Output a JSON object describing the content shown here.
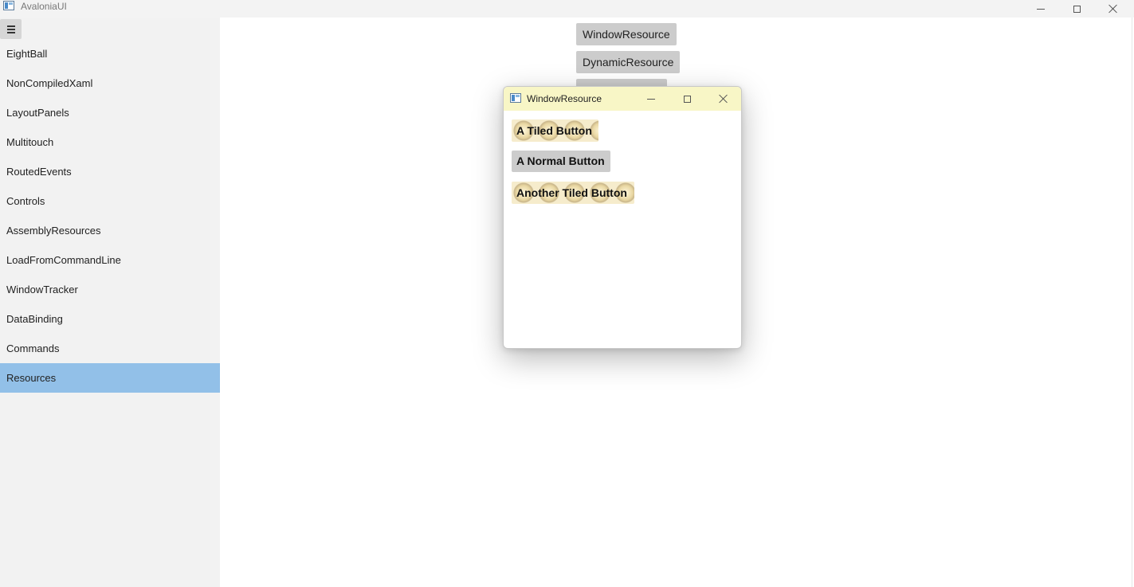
{
  "window": {
    "title": "AvaloniaUI"
  },
  "sidebar": {
    "items": [
      {
        "label": "EightBall"
      },
      {
        "label": "NonCompiledXaml"
      },
      {
        "label": "LayoutPanels"
      },
      {
        "label": "Multitouch"
      },
      {
        "label": "RoutedEvents"
      },
      {
        "label": "Controls"
      },
      {
        "label": "AssemblyResources"
      },
      {
        "label": "LoadFromCommandLine"
      },
      {
        "label": "WindowTracker"
      },
      {
        "label": "DataBinding"
      },
      {
        "label": "Commands"
      },
      {
        "label": "Resources"
      }
    ],
    "selected": "Resources"
  },
  "main": {
    "window_resource_label": "WindowResource",
    "dynamic_resource_label": "DynamicResource"
  },
  "popup": {
    "title": "WindowResource",
    "tiled_button_label": "A Tiled Button",
    "normal_button_label": "A Normal Button",
    "another_tiled_button_label": "Another Tiled Button"
  },
  "colors": {
    "selected_item": "#92c0e8",
    "popup_titlebar": "#f8f6c6",
    "button": "#cccccc"
  }
}
